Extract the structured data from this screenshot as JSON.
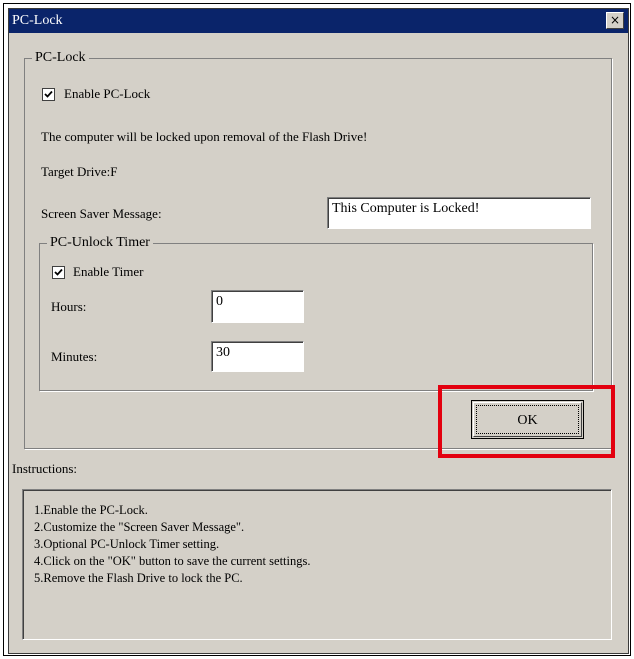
{
  "window": {
    "title": "PC-Lock",
    "close_label": "×"
  },
  "pclock_group": {
    "legend": "PC-Lock",
    "enable_label": "Enable PC-Lock",
    "enable_checked": true,
    "notice": "The computer will be locked upon removal of the Flash Drive!",
    "target_drive": "Target Drive:F",
    "screen_saver_label": "Screen Saver Message:",
    "screen_saver_value": "This Computer is Locked!"
  },
  "timer_group": {
    "legend": "PC-Unlock Timer",
    "enable_label": "Enable Timer",
    "enable_checked": true,
    "hours_label": "Hours:",
    "hours_value": "0",
    "minutes_label": "Minutes:",
    "minutes_value": "30"
  },
  "ok_button": {
    "label": "OK"
  },
  "highlight": {
    "color": "#e3000f"
  },
  "instructions": {
    "label": "Instructions:",
    "lines": [
      "1.Enable the PC-Lock.",
      "2.Customize the \"Screen Saver Message\".",
      "3.Optional PC-Unlock Timer setting.",
      "4.Click on the \"OK\" button to save the current settings.",
      "5.Remove the Flash Drive to lock the PC."
    ]
  }
}
